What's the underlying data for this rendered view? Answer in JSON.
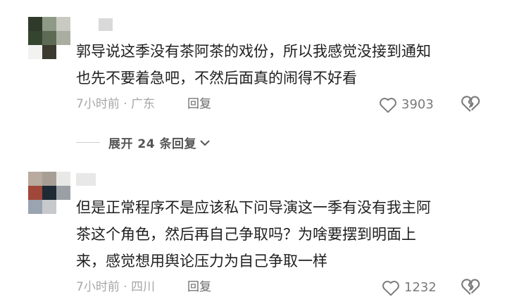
{
  "comments": [
    {
      "text_lines": [
        "郭导说这季没有茶阿茶的戏份，所以我感觉没接到通知",
        "也先不要着急吧，不然后面真的闹得不好看"
      ],
      "meta": "7小时前 · 广东",
      "reply_label": "回复",
      "likes": "3903"
    },
    {
      "text_lines": [
        "但是正常程序不是应该私下问导演这一季有没有我主阿",
        "茶这个角色，然后再自己争取吗？为啥要摆到明面上",
        "来，感觉想用舆论压力为自己争取一样"
      ],
      "meta": "7小时前 · 四川",
      "reply_label": "回复",
      "likes": "1232"
    }
  ],
  "expand_replies": {
    "label": "展开 24 条回复"
  },
  "colors": {
    "text": "#1f1f1f",
    "meta": "#a6a6a6",
    "icon": "#7a7a7a"
  }
}
